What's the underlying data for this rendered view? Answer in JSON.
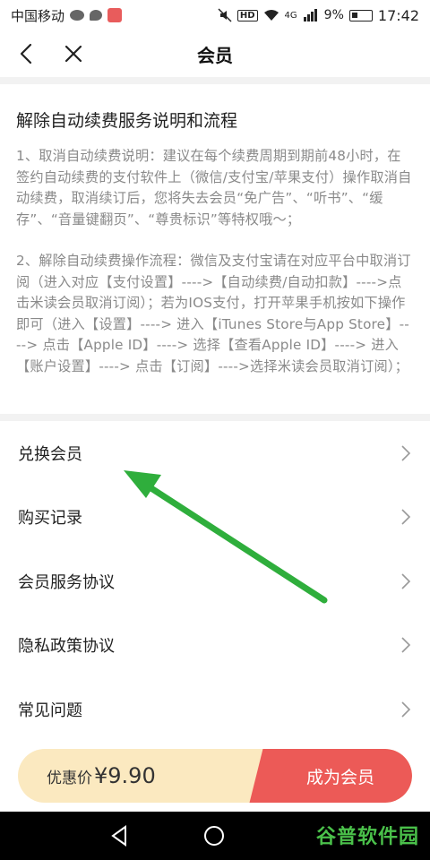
{
  "status_bar": {
    "carrier": "中国移动",
    "hd": "HD",
    "network": "4G",
    "battery_percent": "9%",
    "time": "17:42"
  },
  "nav": {
    "title": "会员"
  },
  "info": {
    "title": "解除自动续费服务说明和流程",
    "paragraph1": "1、取消自动续费说明：建议在每个续费周期到期前48小时，在签约自动续费的支付软件上（微信/支付宝/苹果支付）操作取消自动续费，取消续订后，您将失去会员“免广告”、“听书”、“缓存”、“音量键翻页”、“尊贵标识”等特权哦～；",
    "paragraph2": "2、解除自动续费操作流程：微信及支付宝请在对应平台中取消订阅（进入对应【支付设置】---->【自动续费/自动扣款】---->点击米读会员取消订阅）；若为IOS支付，打开苹果手机按如下操作即可（进入【设置】----> 进入【iTunes Store与App Store】----> 点击【Apple ID】----> 选择【查看Apple ID】----> 进入【账户设置】----> 点击【订阅】---->选择米读会员取消订阅）；"
  },
  "menu": {
    "items": [
      {
        "label": "兑换会员"
      },
      {
        "label": "购买记录"
      },
      {
        "label": "会员服务协议"
      },
      {
        "label": "隐私政策协议"
      },
      {
        "label": "常见问题"
      }
    ]
  },
  "purchase": {
    "price_label": "优惠价",
    "price_value": "¥9.90",
    "join_label": "成为会员"
  },
  "watermark": "谷普软件园",
  "colors": {
    "accent": "#ec5a57",
    "pill": "#fbe9c0",
    "annotation_arrow": "#2fae3c"
  }
}
